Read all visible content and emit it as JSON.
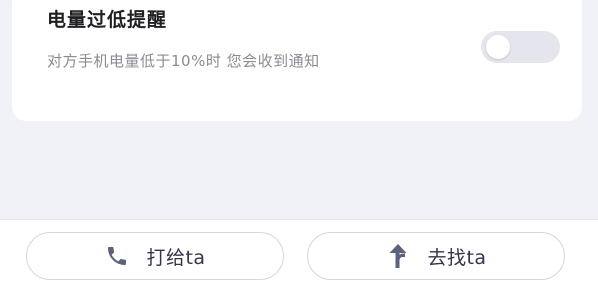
{
  "reminder": {
    "title": "电量过低提醒",
    "description": "对方手机电量低于10%时 您会收到通知",
    "toggle_on": false
  },
  "actions": {
    "call_label": "打给ta",
    "find_label": "去找ta",
    "call_icon": "phone-icon",
    "find_icon": "direction-icon"
  },
  "colors": {
    "icon": "#5b6279",
    "toggle_off": "#e5e6ed",
    "background": "#f1f2f7"
  }
}
